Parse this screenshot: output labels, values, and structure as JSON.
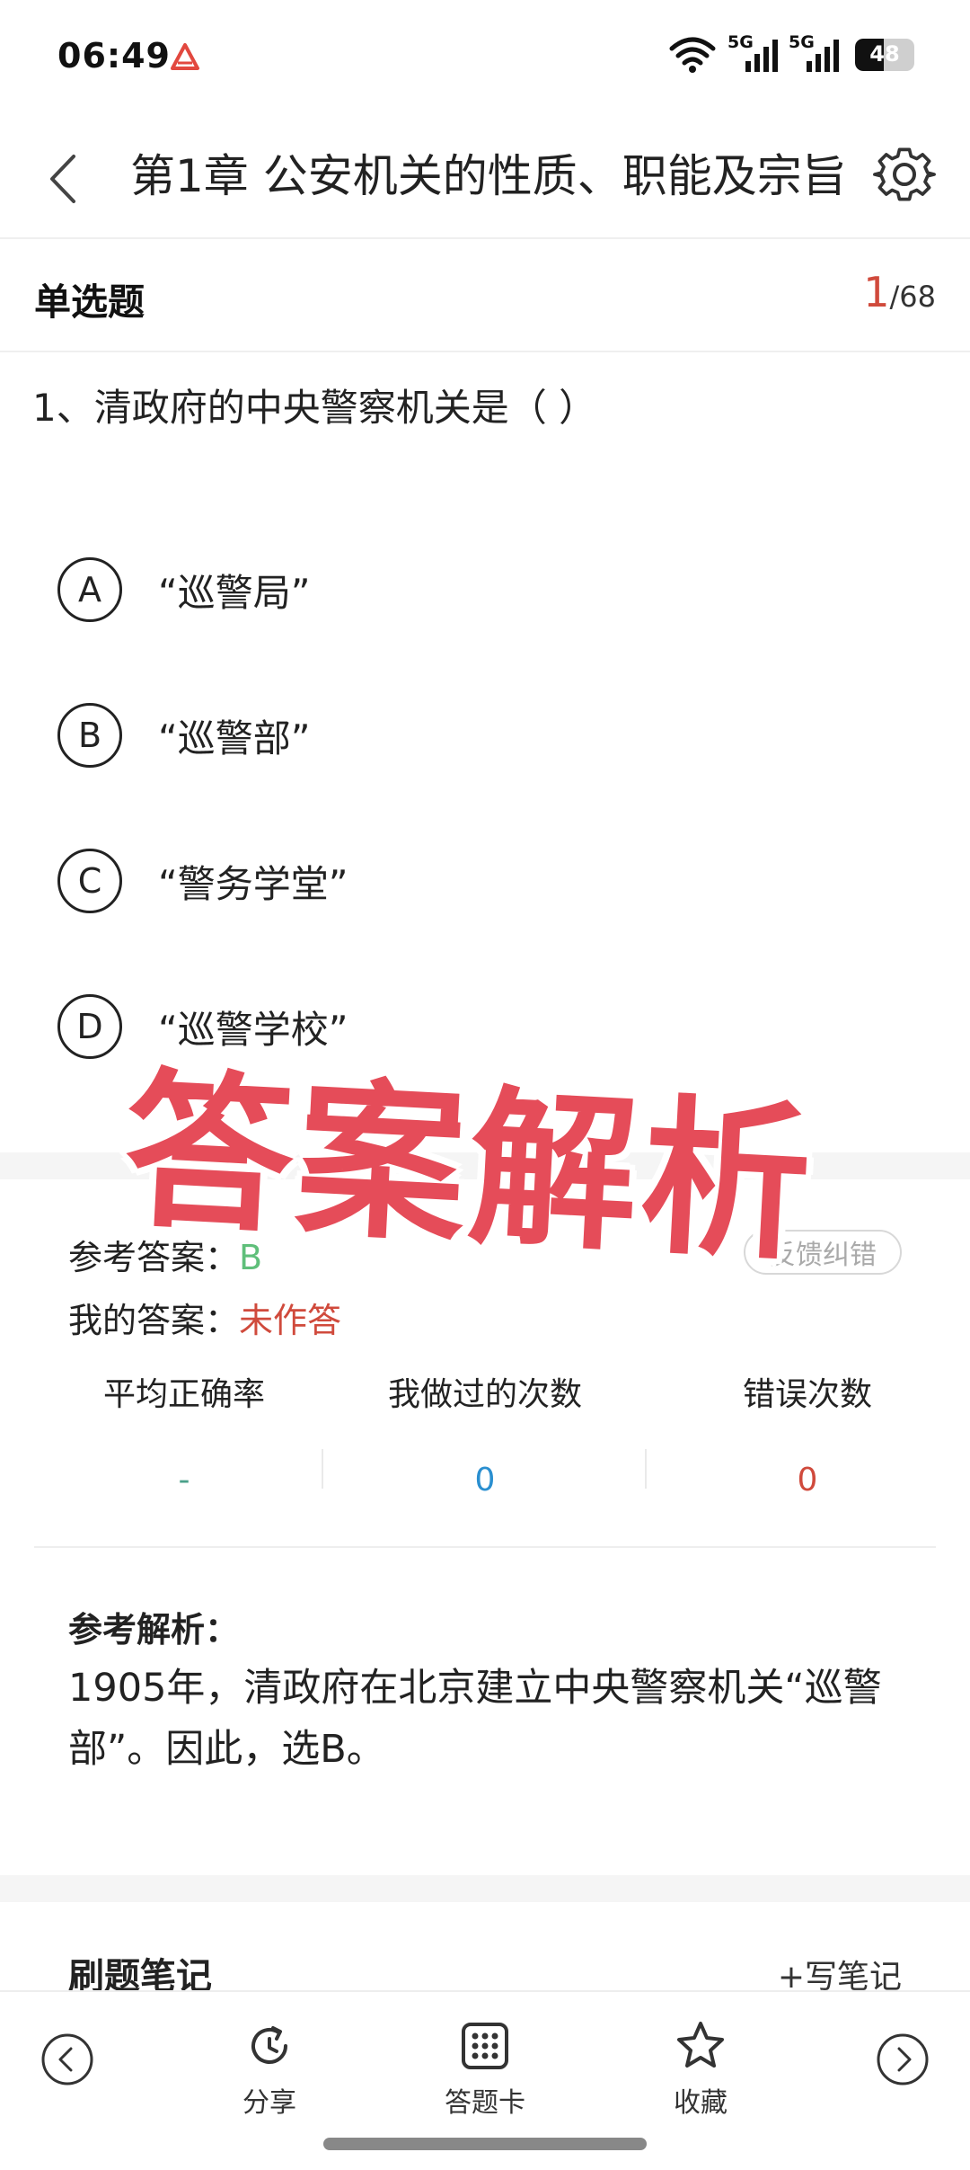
{
  "status_bar": {
    "time": "06:49",
    "signal1_label": "5G",
    "signal2_label": "5G",
    "battery": "48",
    "battery_level": 0.48
  },
  "header": {
    "title": "第1章 公安机关的性质、职能及宗旨"
  },
  "section": {
    "title": "单选题",
    "current": "1",
    "total": "/68"
  },
  "question": {
    "text": "1、清政府的中央警察机关是（    ）",
    "options": [
      {
        "letter": "A",
        "text": "“巡警局”"
      },
      {
        "letter": "B",
        "text": "“巡警部”"
      },
      {
        "letter": "C",
        "text": "“警务学堂”"
      },
      {
        "letter": "D",
        "text": "“巡警学校”"
      }
    ]
  },
  "overlay": {
    "text": "答案解析"
  },
  "answer": {
    "ref_label": "参考答案：",
    "ref_value": "B",
    "mine_label": "我的答案：",
    "mine_value": "未作答",
    "report_label": "反馈纠错"
  },
  "stats": [
    {
      "label": "平均正确率",
      "value": "-",
      "color": "#4aa08a"
    },
    {
      "label": "我做过的次数",
      "value": "0",
      "color": "#2a8fd0"
    },
    {
      "label": "错误次数",
      "value": "0",
      "color": "#d04a3c"
    }
  ],
  "analysis": {
    "title": "参考解析：",
    "body": "1905年，清政府在北京建立中央警察机关“巡警部”。因此，选B。"
  },
  "notes": {
    "title": "刷题笔记",
    "write_label": "+写笔记"
  },
  "bottom_nav": {
    "prev_icon": "chevron-left-circle-icon",
    "next_icon": "chevron-right-circle-icon",
    "items": [
      {
        "label": "分享",
        "icon": "share-refresh-icon"
      },
      {
        "label": "答题卡",
        "icon": "grid-card-icon"
      },
      {
        "label": "收藏",
        "icon": "star-icon"
      }
    ]
  }
}
